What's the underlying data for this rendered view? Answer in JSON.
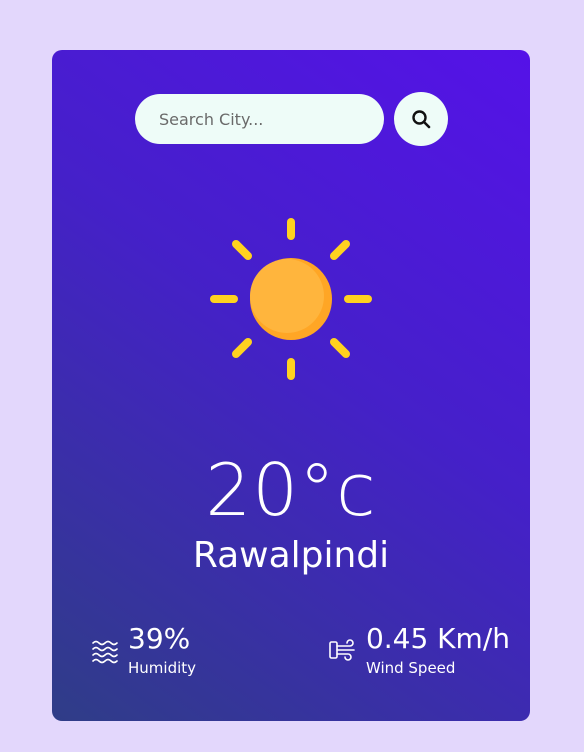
{
  "search": {
    "placeholder": "Search City...",
    "button_icon": "search-icon"
  },
  "weather": {
    "icon": "sun-icon",
    "temperature": "20°c",
    "city": "Rawalpindi"
  },
  "details": {
    "humidity": {
      "icon": "humidity-icon",
      "value": "39%",
      "label": "Humidity"
    },
    "wind": {
      "icon": "wind-icon",
      "value": "0.45 Km/h",
      "label": "Wind Speed"
    }
  },
  "colors": {
    "page_bg": "#e3d7fc",
    "card_gradient_top": "#5512e8",
    "card_gradient_bottom": "#2f3d87",
    "input_bg": "#eefcf8",
    "sun_core": "#ffb53d",
    "sun_rays": "#ffd21f"
  }
}
